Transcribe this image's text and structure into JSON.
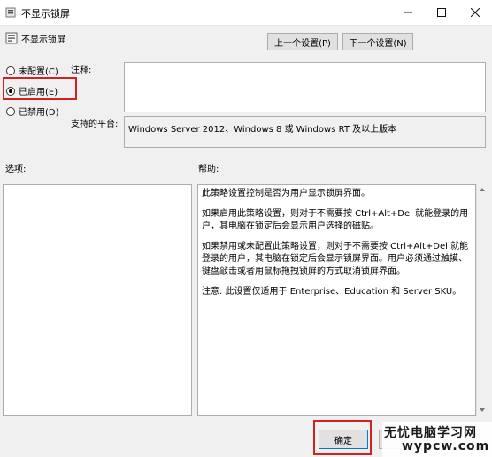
{
  "window": {
    "title": "不显示锁屏"
  },
  "header": {
    "policy_name": "不显示锁屏",
    "prev_label": "上一个设置(P)",
    "next_label": "下一个设置(N)"
  },
  "state": {
    "options": [
      {
        "label": "未配置(C)",
        "checked": false
      },
      {
        "label": "已启用(E)",
        "checked": true
      },
      {
        "label": "已禁用(D)",
        "checked": false
      }
    ]
  },
  "comment": {
    "label": "注释:",
    "value": ""
  },
  "platform": {
    "label": "支持的平台:",
    "value": "Windows Server 2012、Windows 8 或 Windows RT 及以上版本"
  },
  "options_section": {
    "label": "选项:"
  },
  "help_section": {
    "label": "帮助:",
    "paragraphs": [
      "此策略设置控制是否为用户显示锁屏界面。",
      "如果启用此策略设置，则对于不需要按 Ctrl+Alt+Del 就能登录的用户，其电脑在锁定后会显示用户选择的磁贴。",
      "如果禁用或未配置此策略设置，则对于不需要按 Ctrl+Alt+Del 就能登录的用户，其电脑在锁定后会显示锁屏界面。用户必须通过触摸、键盘敲击或者用鼠标拖拽锁屏的方式取消锁屏界面。",
      "注意: 此设置仅适用于 Enterprise、Education 和 Server SKU。"
    ]
  },
  "footer": {
    "ok_label": "确定"
  },
  "watermark": {
    "line1": "无忧电脑学习网",
    "line2": "wypcw.com"
  },
  "colors": {
    "highlight": "#d32121"
  }
}
